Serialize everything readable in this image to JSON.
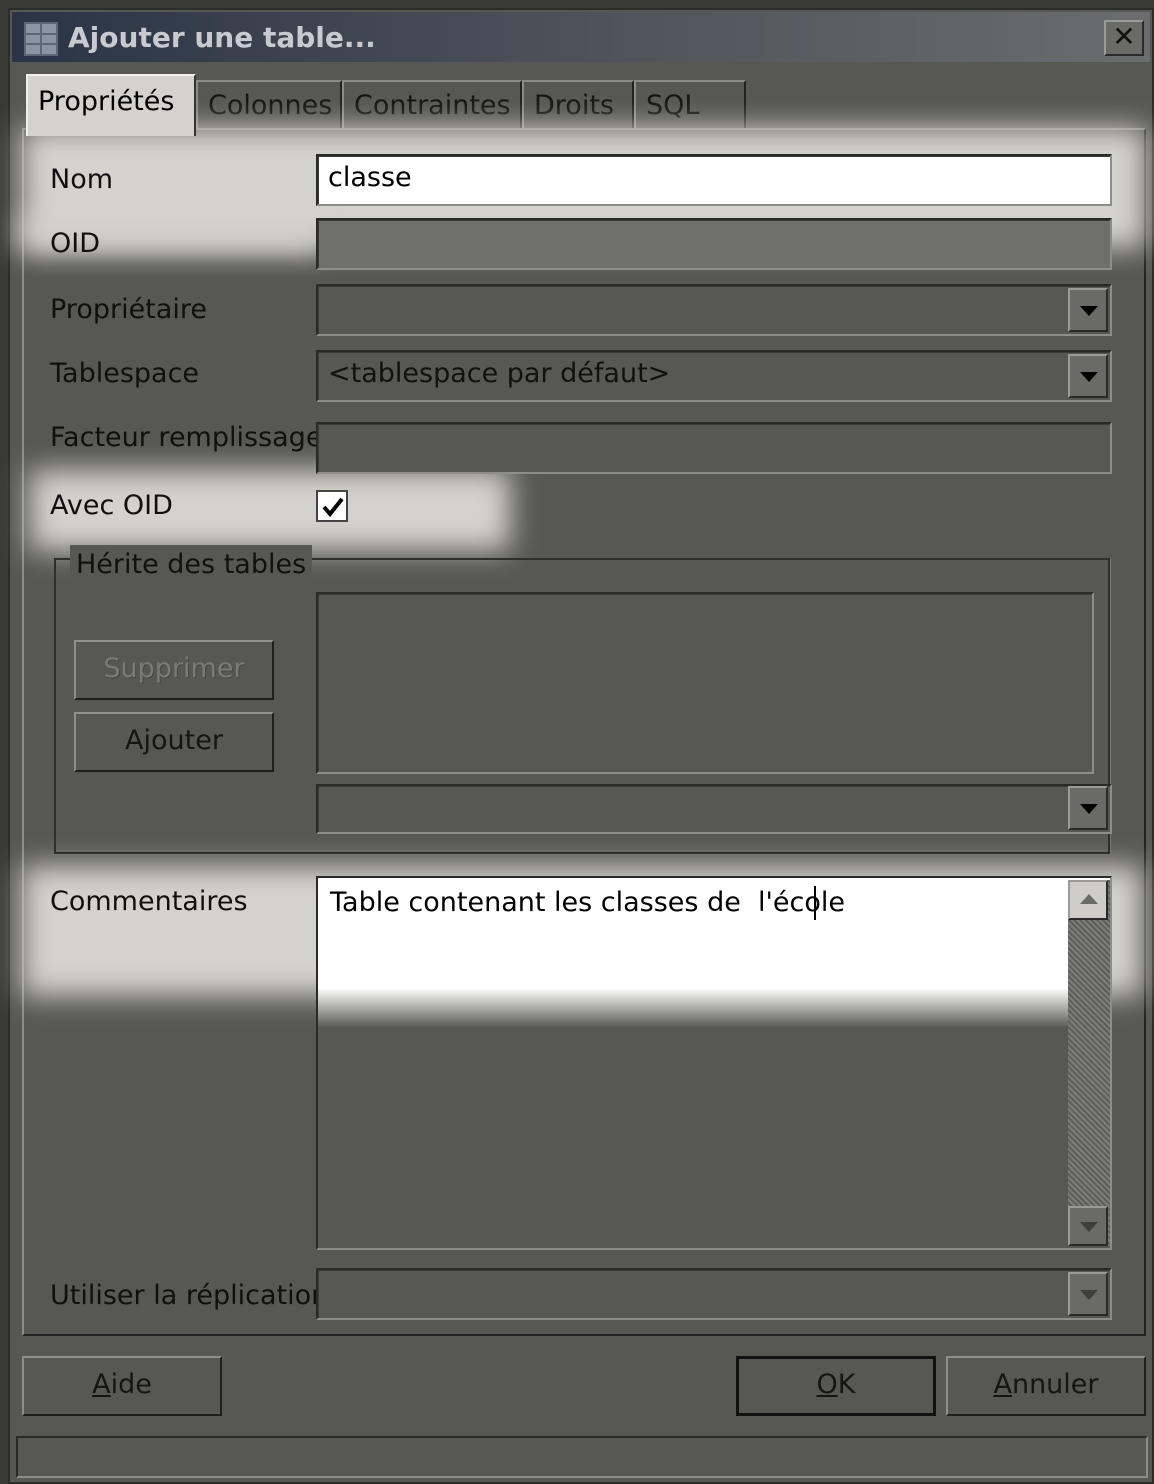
{
  "window": {
    "title": "Ajouter une table...",
    "close_glyph": "✕"
  },
  "tabs": [
    {
      "label": "Propriétés",
      "active": true
    },
    {
      "label": "Colonnes"
    },
    {
      "label": "Contraintes"
    },
    {
      "label": "Droits"
    },
    {
      "label": "SQL"
    }
  ],
  "form": {
    "nom": {
      "label": "Nom",
      "value": "classe"
    },
    "oid": {
      "label": "OID",
      "value": ""
    },
    "proprietaire": {
      "label": "Propriétaire",
      "value": ""
    },
    "tablespace": {
      "label": "Tablespace",
      "value": "<tablespace par défaut>"
    },
    "facteur": {
      "label": "Facteur remplissage",
      "value": ""
    },
    "avec_oid": {
      "label": "Avec OID",
      "checked": true
    },
    "herite": {
      "label": "Hérite des tables",
      "supprimer_label": "Supprimer",
      "ajouter_label": "Ajouter"
    },
    "commentaires": {
      "label": "Commentaires",
      "value": "Table contenant les classes de  l'école"
    },
    "replication": {
      "label": "Utiliser la réplication",
      "value": ""
    }
  },
  "buttons": {
    "aide": {
      "label": "Aide",
      "mnemonic": "A",
      "rest": "ide"
    },
    "ok": {
      "label": "OK",
      "mnemonic": "O",
      "rest": "K"
    },
    "annuler": {
      "label": "Annuler",
      "mnemonic": "A",
      "rest": "nnuler"
    }
  },
  "icons": {
    "window_icon": "table-icon",
    "checkmark": "checkmark-icon",
    "dropdown": "chevron-down-icon"
  }
}
